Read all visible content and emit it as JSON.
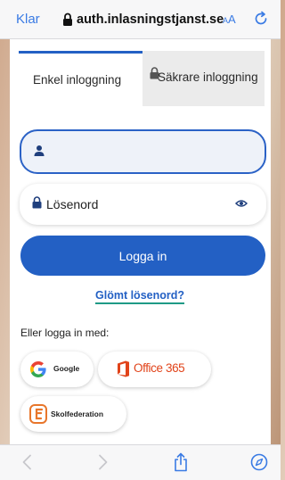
{
  "browser": {
    "done_label": "Klar",
    "url": "auth.inlasningstjanst.se",
    "text_size_small": "A",
    "text_size_large": "A"
  },
  "tabs": [
    {
      "label": "Enkel inloggning",
      "active": true
    },
    {
      "label": "Säkrare inloggning",
      "active": false
    }
  ],
  "form": {
    "username_value": "",
    "password_placeholder": "Lösenord",
    "login_button": "Logga in",
    "forgot_link": "Glömt lösenord?"
  },
  "social": {
    "heading": "Eller logga in med:",
    "google_label": "Google",
    "office_label": "Office 365",
    "skolfederation_label": "Skolfederation"
  },
  "colors": {
    "accent": "#2360c4",
    "safari_blue": "#3a7be4",
    "office_red": "#e1431a",
    "link_underline": "#1f9a86"
  },
  "icons": [
    "lock-icon",
    "reload-icon",
    "user-icon",
    "eye-icon",
    "google-icon",
    "office-icon",
    "skolfederation-icon",
    "back-icon",
    "forward-icon",
    "share-icon",
    "compass-icon"
  ]
}
